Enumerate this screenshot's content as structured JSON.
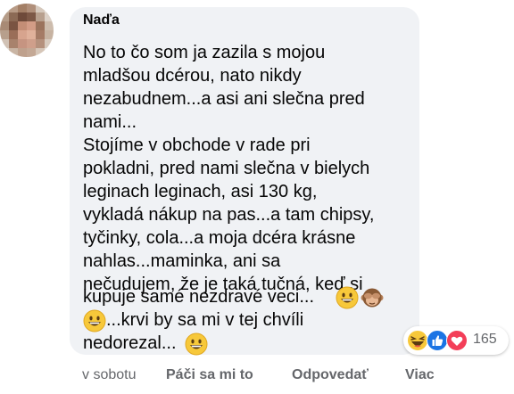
{
  "comment": {
    "author": "Naďa",
    "text_lines": [
      "No to čo som ja zazila s mojou",
      "mladšou dcérou, nato nikdy",
      "nezabudnem...a asi ani slečna pred",
      "nami...",
      "Stojíme v obchode v rade pri",
      "pokladni, pred nami slečna v bielych",
      "leginach leginach, asi 130 kg,",
      "vykladá nákup na pas...a tam chipsy,",
      "tyčinky, cola...a moja dcéra krásne",
      "nahlas...maminka, ani sa",
      "nečudujem, že je taká tučná, keď si",
      "kupuje samé nezdravé veci...",
      "...krvi by sa mi v tej chvíli",
      "nedorezal..."
    ],
    "inline_emoji": [
      "grinning-face",
      "see-no-evil-monkey",
      "grinning-face",
      "grinning-face"
    ],
    "reactions": {
      "types": [
        "haha",
        "like",
        "love"
      ],
      "count": "165"
    }
  },
  "actions": {
    "timestamp": "v sobotu",
    "like": "Páči sa mi to",
    "reply": "Odpovedať",
    "more": "Viac"
  }
}
